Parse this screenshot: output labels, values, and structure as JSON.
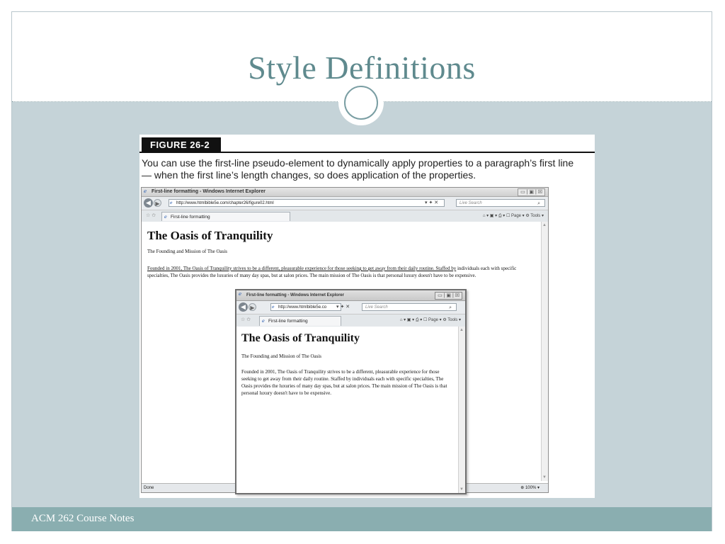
{
  "slide": {
    "title": "Style Definitions",
    "footer": "ACM 262 Course Notes"
  },
  "figure": {
    "label": "FIGURE 26-2",
    "caption": "You can use the first-line pseudo-element to dynamically apply properties to a paragraph’s first line — when the first line’s length changes, so does application of the properties."
  },
  "browser_main": {
    "window_title": "First-line formatting - Windows Internet Explorer",
    "window_controls": "▭ | ▣ | ☒",
    "url": "http://www.htmlbible5e.com/chapter26/figure02.html",
    "address_controls": "▾ ✦ ✕",
    "search_placeholder": "Live Search",
    "search_icon": "search-icon",
    "tab_label": "First-line formatting",
    "toolbar": "⌂ ▾ ▣ ▾ ⎙ ▾ ☐ Page ▾ ⚙ Tools ▾",
    "page": {
      "heading": "The Oasis of Tranquility",
      "subtitle": "The Founding and Mission of The Oasis",
      "paragraph_first_line": "Founded in 2001, The Oasis of Tranquility strives to be a different, pleasurable experience for those seeking to get away from their daily routine. Staffed by",
      "paragraph_rest": "individuals each with specific specialties, The Oasis provides the luxuries of many day spas, but at salon prices. The main mission of The Oasis is that personal luxury doesn't have to be expensive."
    },
    "status": "Done",
    "zoom": "100%"
  },
  "browser_small": {
    "window_title": "First-line formatting - Windows Internet Explorer",
    "url": "http://www.htmlbible5e.co",
    "address_controls": "▾ ✦ ✕",
    "search_placeholder": "Live Search",
    "tab_label": "First-line formatting",
    "toolbar": "⌂ ▾ ▣ ▾ ⎙ ▾ ☐ Page ▾ ⚙ Tools ▾",
    "page": {
      "heading": "The Oasis of Tranquility",
      "subtitle": "The Founding and Mission of The Oasis",
      "paragraph": "Founded in 2001, The Oasis of Tranquility strives to be a different, pleasurable experience for those seeking to get away from their daily routine. Staffed by individuals each with specific specialties, The Oasis provides the luxuries of many day spas, but at salon prices. The main mission of The Oasis is that personal luxury doesn't have to be expensive."
    }
  },
  "colors": {
    "title": "#5f8a8e",
    "band": "#c5d3d8",
    "footer": "#8aaeb0"
  }
}
